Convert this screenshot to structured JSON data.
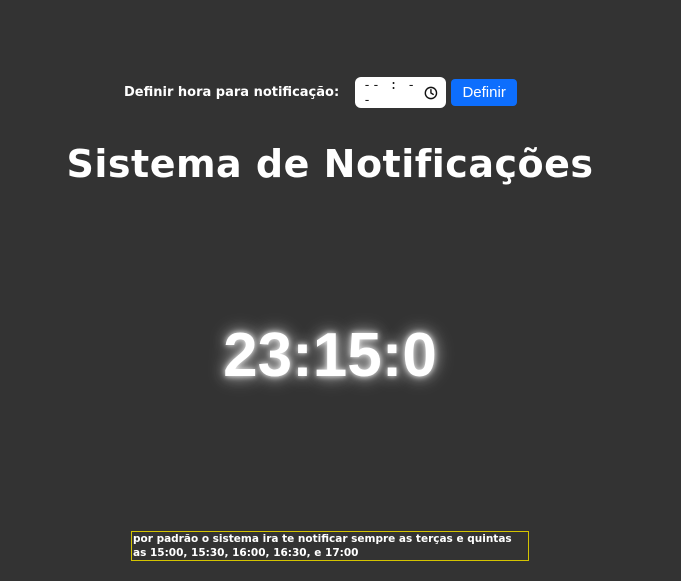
{
  "form": {
    "label": "Definir hora para notificação:",
    "time_placeholder": "-- : --",
    "time_icon": "clock-icon",
    "button_label": "Definir"
  },
  "title": "Sistema de Notificações",
  "clock": {
    "time": "23:15:0"
  },
  "footer": {
    "note": "por padrão o sistema ira te notificar sempre as terças e quintas as 15:00, 15:30, 16:00, 16:30, e 17:00"
  },
  "colors": {
    "background": "#333333",
    "button": "#0d6efd",
    "note_border": "#d4c400"
  }
}
